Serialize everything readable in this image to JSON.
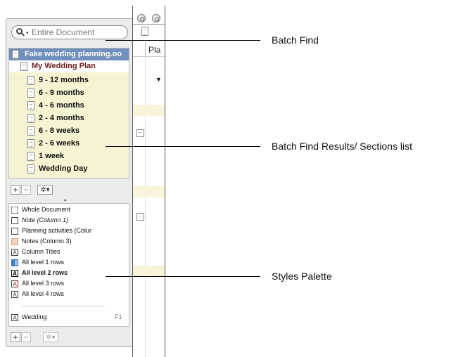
{
  "search": {
    "placeholder": "Entire Document"
  },
  "results": {
    "document": "Fake wedding planning.oo",
    "plan": "My Wedding Plan",
    "sections": [
      "9 - 12 months",
      "6 - 9 months",
      "4 - 6 months",
      "2 - 4 months",
      "6 - 8 weeks",
      "2 - 6 weeks",
      "1 week",
      "Wedding Day"
    ]
  },
  "results_bar": {
    "add": "+",
    "remove": "−",
    "gear": "✲▾"
  },
  "styles": {
    "items": [
      {
        "label": "Whole Document",
        "icon": "dashed-box-icon"
      },
      {
        "label": "Note (Column 1)",
        "icon": "plain-box-icon",
        "italic": true
      },
      {
        "label": "Planning activities (Colur",
        "icon": "plain-box-icon"
      },
      {
        "label": "Notes (Column 3)",
        "icon": "peach-box-icon"
      },
      {
        "label": "Column Titles",
        "icon": "letter-a-icon"
      },
      {
        "label": "All level 1 rows",
        "icon": "blue-grid-icon"
      },
      {
        "label": "All level 2 rows",
        "icon": "bold-letter-a-icon",
        "bold": true
      },
      {
        "label": "All level 3 rows",
        "icon": "red-letter-a-icon"
      },
      {
        "label": "All level 4 rows",
        "icon": "letter-a-icon"
      }
    ],
    "named": {
      "label": "Wedding",
      "shortcut": "F1"
    }
  },
  "styles_bar": {
    "add": "+",
    "remove": "−",
    "gear": "✲▾"
  },
  "docwin": {
    "column_header": "Pla",
    "disclosure": "▼"
  },
  "callouts": {
    "batch_find": "Batch Find",
    "results": "Batch Find Results/ Sections list",
    "styles": "Styles Palette"
  },
  "colors": {
    "selection": "#6f8fbc",
    "results_bg": "#f6f3d2",
    "plan_text": "#6b1a1a",
    "row_highlight": "#f7f4da"
  }
}
